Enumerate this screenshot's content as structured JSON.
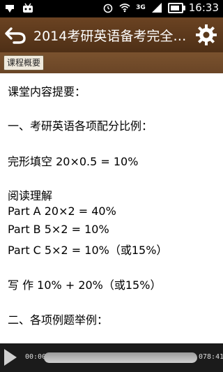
{
  "status_bar": {
    "time": "16:33",
    "network": "3G"
  },
  "toolbar": {
    "title": "2014考研英语备考完全…"
  },
  "tabs": [
    {
      "label": "课程概要"
    }
  ],
  "content": {
    "lines": [
      "课堂内容提要：",
      "一、考研英语各项配分比例：",
      "完形填空 20×0.5 = 10%",
      "阅读理解",
      "Part A 20×2 = 40%",
      "Part B 5×2 = 10%",
      "Part C 5×2 = 10%（或15%）",
      "写 作 10% + 20%（或15%）",
      "二、各项例题举例："
    ]
  },
  "player": {
    "current_time": "00:00",
    "total_time": "078:41",
    "progress": 0.0
  }
}
